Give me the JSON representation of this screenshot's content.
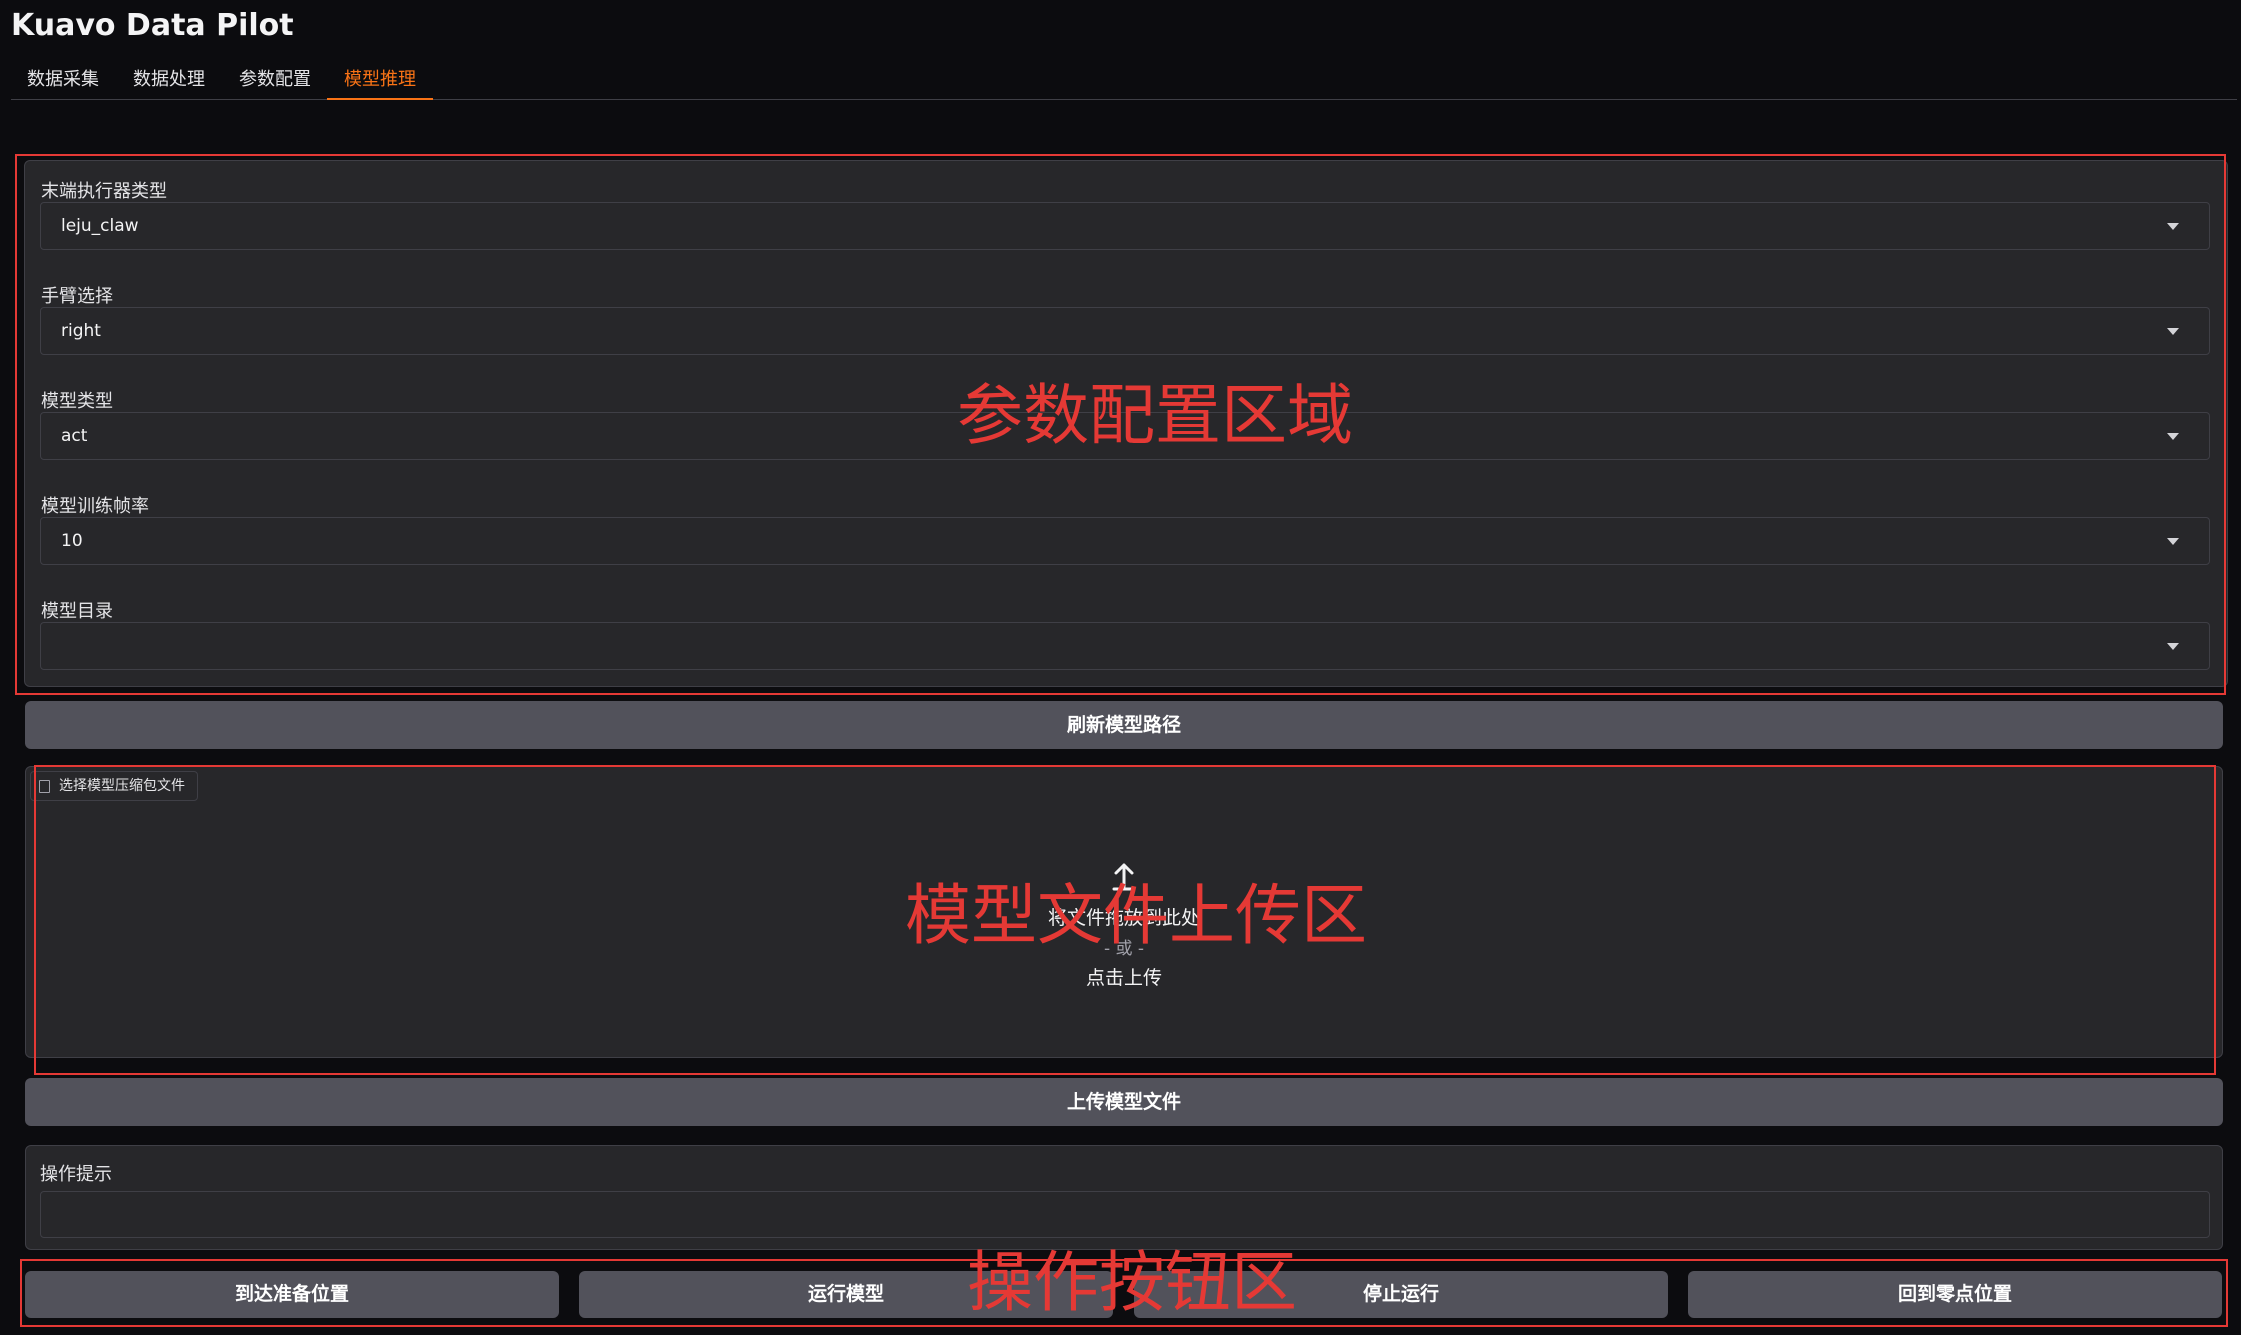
{
  "app": {
    "title": "Kuavo Data Pilot"
  },
  "tabs": [
    {
      "label": "数据采集",
      "active": false
    },
    {
      "label": "数据处理",
      "active": false
    },
    {
      "label": "参数配置",
      "active": false
    },
    {
      "label": "模型推理",
      "active": true
    }
  ],
  "config": {
    "fields": [
      {
        "label": "末端执行器类型",
        "value": "leju_claw"
      },
      {
        "label": "手臂选择",
        "value": "right"
      },
      {
        "label": "模型类型",
        "value": "act"
      },
      {
        "label": "模型训练帧率",
        "value": "10"
      },
      {
        "label": "模型目录",
        "value": ""
      }
    ]
  },
  "refresh_button": "刷新模型路径",
  "upload": {
    "chip_label": "选择模型压缩包文件",
    "drop_text": "将文件拖放到此处",
    "or_text": "- 或 -",
    "click_text": "点击上传",
    "button": "上传模型文件"
  },
  "hint": {
    "label": "操作提示",
    "value": ""
  },
  "actions": [
    {
      "label": "到达准备位置"
    },
    {
      "label": "运行模型"
    },
    {
      "label": "停止运行"
    },
    {
      "label": "回到零点位置"
    }
  ],
  "annotations": [
    {
      "label": "参数配置区域"
    },
    {
      "label": "模型文件上传区"
    },
    {
      "label": "操作按钮区"
    }
  ],
  "colors": {
    "background": "#0c0c0f",
    "panel": "#27272a",
    "button": "#52525b",
    "accent": "#f97316",
    "annotation": "#e53935"
  }
}
